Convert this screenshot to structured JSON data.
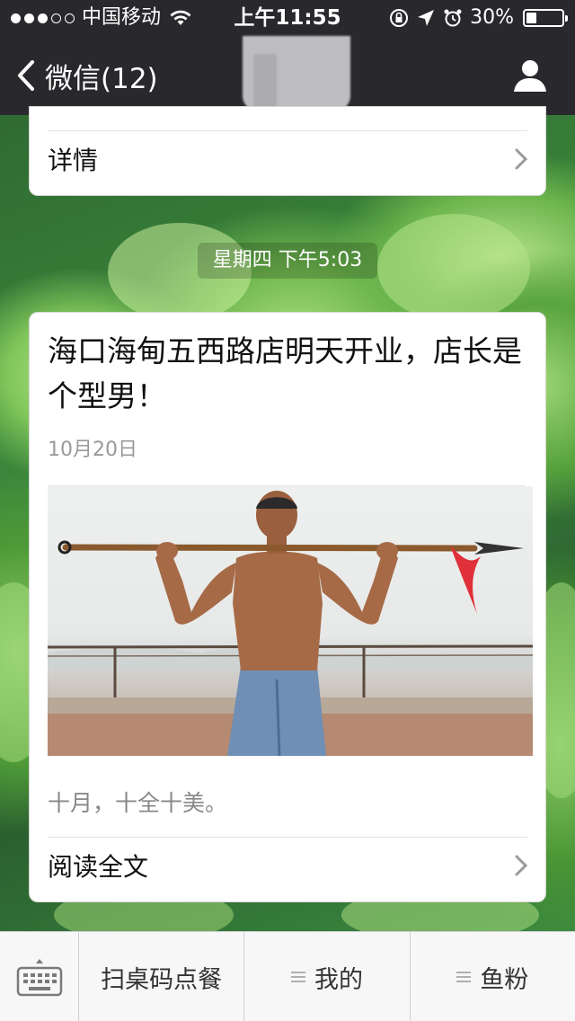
{
  "status_bar": {
    "signal_dots_filled": 3,
    "signal_dots_total": 5,
    "carrier": "中国移动",
    "time": "上午11:55",
    "battery_percent": "30%",
    "battery_level": 0.3
  },
  "nav": {
    "back_label": "微信(12)",
    "back_icon": "chevron-left-icon",
    "profile_icon": "person-icon"
  },
  "prev_card": {
    "details_label": "详情"
  },
  "timestamp": "星期四 下午5:03",
  "article": {
    "title": "海口海甸五西路店明天开业，店长是个型男！",
    "date": "10月20日",
    "cover_icon": "man-holding-spear-photo",
    "summary": "十月，十全十美。",
    "read_more_label": "阅读全文"
  },
  "bottom_menu": {
    "keyboard_icon": "keyboard-icon",
    "items": [
      {
        "label": "扫桌码点餐",
        "has_submenu": false
      },
      {
        "label": "我的",
        "has_submenu": true
      },
      {
        "label": "鱼粉",
        "has_submenu": true
      }
    ]
  },
  "colors": {
    "bar_bg": "#29292d",
    "card_bg": "#ffffff",
    "wallpaper_green": "#3f8a3a"
  }
}
